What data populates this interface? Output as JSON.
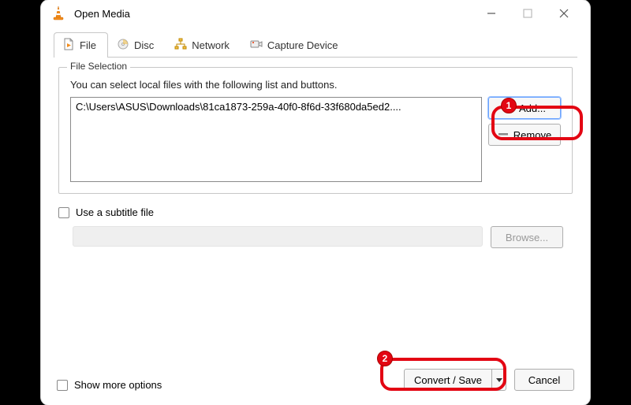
{
  "window": {
    "title": "Open Media"
  },
  "tabs": {
    "file": "File",
    "disc": "Disc",
    "network": "Network",
    "capture": "Capture Device"
  },
  "fileSelection": {
    "legend": "File Selection",
    "hint": "You can select local files with the following list and buttons.",
    "filePath": "C:\\Users\\ASUS\\Downloads\\81ca1873-259a-40f0-8f6d-33f680da5ed2....",
    "addLabel": "Add...",
    "removeLabel": "Remove"
  },
  "subtitle": {
    "checkboxLabel": "Use a subtitle file",
    "browseLabel": "Browse..."
  },
  "footer": {
    "moreOptions": "Show more options",
    "convertLabel": "Convert / Save",
    "cancelLabel": "Cancel"
  },
  "annotations": {
    "badge1": "1",
    "badge2": "2"
  }
}
